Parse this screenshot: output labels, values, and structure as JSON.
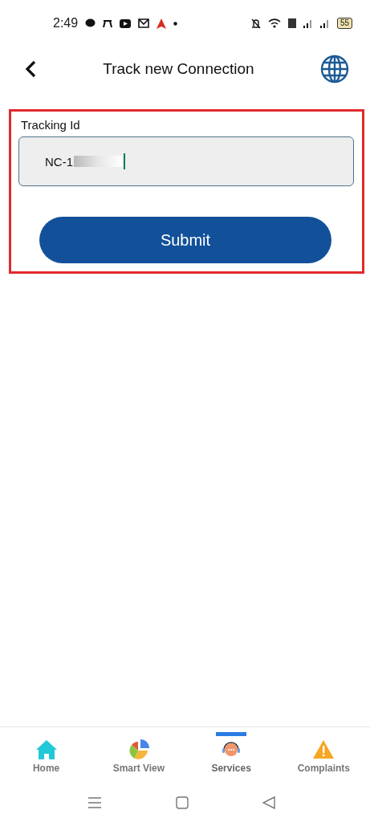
{
  "status_bar": {
    "time": "2:49",
    "battery": "55"
  },
  "header": {
    "title": "Track new Connection"
  },
  "form": {
    "highlighted": true,
    "label": "Tracking Id",
    "value": "NC-1",
    "redacted": true,
    "submit": "Submit"
  },
  "bottom_nav": [
    {
      "label": "Home",
      "kind": "home",
      "selected": false
    },
    {
      "label": "Smart View",
      "kind": "chart",
      "selected": false
    },
    {
      "label": "Services",
      "kind": "support",
      "selected": true
    },
    {
      "label": "Complaints",
      "kind": "warning",
      "selected": false
    }
  ]
}
